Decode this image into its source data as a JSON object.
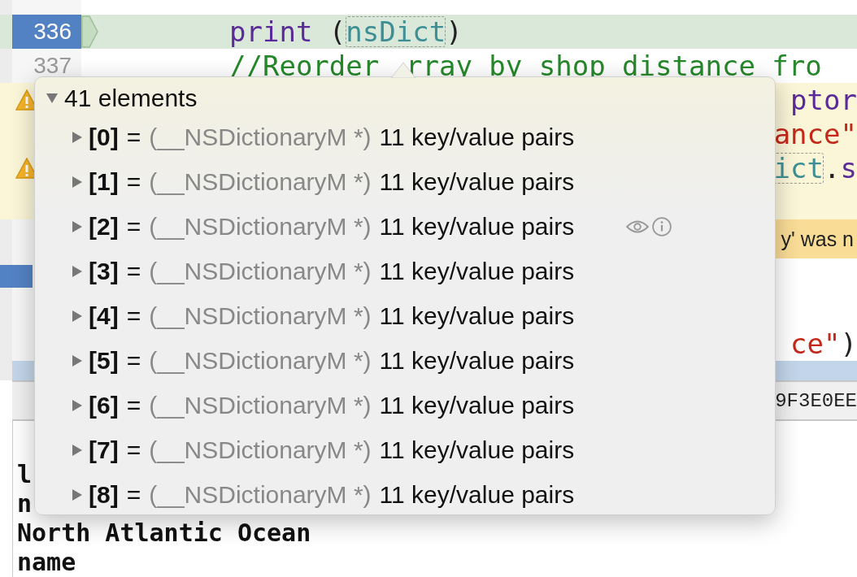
{
  "editor": {
    "lines": [
      {
        "number": "336",
        "current": true,
        "tokens": [
          {
            "text": "print",
            "kind": "keyword"
          },
          {
            "text": " (",
            "kind": "plain"
          },
          {
            "text": "nsDict",
            "kind": "variable"
          },
          {
            "text": ")",
            "kind": "plain"
          }
        ]
      },
      {
        "number": "337",
        "current": false,
        "tokens": [
          {
            "text": "//Reorder",
            "kind": "comment"
          },
          {
            "text": "rray by shop distance fro",
            "kind": "comment"
          }
        ]
      }
    ],
    "partial_lines": [
      {
        "kind": "code",
        "warning": true,
        "issue_icon": true,
        "marker": false,
        "tokens": [
          {
            "text": "ptor",
            "kind": "keyword"
          }
        ]
      },
      {
        "kind": "code",
        "warning": true,
        "issue_icon": false,
        "marker": false,
        "tokens": [
          {
            "text": "ance\"",
            "kind": "string"
          }
        ]
      },
      {
        "kind": "code",
        "warning": true,
        "issue_icon": true,
        "marker": false,
        "tokens": [
          {
            "text": "ict",
            "kind": "variable"
          },
          {
            "text": ".",
            "kind": "plain"
          },
          {
            "text": "s",
            "kind": "keyword"
          }
        ]
      },
      {
        "kind": "code",
        "warning": true,
        "issue_icon": false,
        "marker": false
      },
      {
        "kind": "message",
        "text": "y' was n"
      },
      {
        "kind": "code",
        "warning": false,
        "issue_icon": false,
        "marker": true
      },
      {
        "kind": "code",
        "warning": false,
        "issue_icon": false,
        "marker": false
      },
      {
        "kind": "code",
        "warning": false,
        "issue_icon": false,
        "marker": false,
        "tokens": [
          {
            "text": "ce\"",
            "kind": "string"
          },
          {
            "text": ")",
            "kind": "plain"
          }
        ]
      }
    ]
  },
  "debug_bar": {
    "address": "9F3E0EE"
  },
  "console": {
    "lines": [
      "l",
      "n",
      "North Atlantic Ocean",
      "name"
    ]
  },
  "popover": {
    "title": "41 elements",
    "expanded": true,
    "items": [
      {
        "index": "[0]",
        "equals": "=",
        "type": "(__NSDictionaryM *)",
        "value": "11 key/value pairs",
        "expanded": false,
        "actions": false
      },
      {
        "index": "[1]",
        "equals": "=",
        "type": "(__NSDictionaryM *)",
        "value": "11 key/value pairs",
        "expanded": false,
        "actions": false
      },
      {
        "index": "[2]",
        "equals": "=",
        "type": "(__NSDictionaryM *)",
        "value": "11 key/value pairs",
        "expanded": false,
        "actions": true
      },
      {
        "index": "[3]",
        "equals": "=",
        "type": "(__NSDictionaryM *)",
        "value": "11 key/value pairs",
        "expanded": false,
        "actions": false
      },
      {
        "index": "[4]",
        "equals": "=",
        "type": "(__NSDictionaryM *)",
        "value": "11 key/value pairs",
        "expanded": false,
        "actions": false
      },
      {
        "index": "[5]",
        "equals": "=",
        "type": "(__NSDictionaryM *)",
        "value": "11 key/value pairs",
        "expanded": false,
        "actions": false
      },
      {
        "index": "[6]",
        "equals": "=",
        "type": "(__NSDictionaryM *)",
        "value": "11 key/value pairs",
        "expanded": false,
        "actions": false
      },
      {
        "index": "[7]",
        "equals": "=",
        "type": "(__NSDictionaryM *)",
        "value": "11 key/value pairs",
        "expanded": false,
        "actions": false
      },
      {
        "index": "[8]",
        "equals": "=",
        "type": "(__NSDictionaryM *)",
        "value": "11 key/value pairs",
        "expanded": false,
        "actions": false
      }
    ]
  }
}
